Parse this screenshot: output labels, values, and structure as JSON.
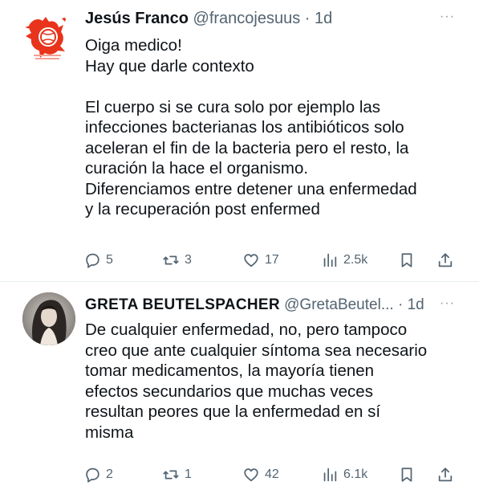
{
  "tweets": [
    {
      "author_name": "Jesús Franco",
      "handle": "@francojesuus",
      "separator": "·",
      "time": "1d",
      "more": "···",
      "avatar_text": "Franco · Pitcher",
      "lines": [
        "Oiga medico!",
        "Hay que darle contexto",
        "",
        "El cuerpo si se cura solo por ejemplo las",
        "infecciones bacterianas los antibióticos solo",
        "aceleran el fin de la bacteria pero el resto, la",
        "curación la hace el organismo.",
        "Diferenciamos entre detener una enfermedad",
        "y la recuperación post enfermed"
      ],
      "replies": "5",
      "retweets": "3",
      "likes": "17",
      "views": "2.5k"
    },
    {
      "author_name": "GRETA BEUTELSPACHER",
      "handle": "@GretaBeutel...",
      "separator": "·",
      "time": "1d",
      "more": "···",
      "lines": [
        "De cualquier enfermedad, no, pero tampoco",
        "creo que ante cualquier síntoma sea necesario",
        "tomar medicamentos, la mayoría tienen",
        "efectos secundarios que muchas veces",
        "resultan peores que la enfermedad en sí",
        "misma"
      ],
      "replies": "2",
      "retweets": "1",
      "likes": "42",
      "views": "6.1k"
    }
  ],
  "icons": {
    "reply": "reply-icon",
    "retweet": "retweet-icon",
    "like": "heart-icon",
    "views": "views-icon",
    "bookmark": "bookmark-icon",
    "share": "share-icon"
  },
  "colors": {
    "text": "#0f1419",
    "secondary": "#536471",
    "divider": "#e6ecf0",
    "logo_red": "#e8341c"
  }
}
